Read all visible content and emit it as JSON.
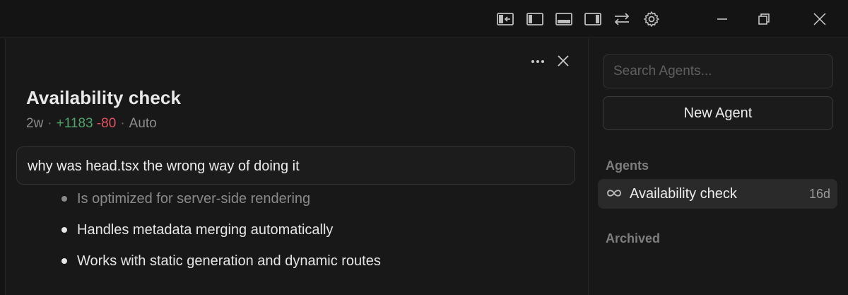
{
  "colors": {
    "background": "#181818",
    "titlebar": "#141414",
    "added": "#4fa36a",
    "removed": "#e0525e",
    "selected_item": "#2a2a2a"
  },
  "titlebar": {
    "icons": [
      "panel-toggle-left-arrow-icon",
      "layout-sidebar-left-icon",
      "layout-panel-bottom-icon",
      "layout-sidebar-right-icon",
      "swap-arrows-icon",
      "gear-icon"
    ],
    "window_controls": [
      "minimize-icon",
      "restore-icon",
      "close-icon"
    ]
  },
  "main": {
    "agent": {
      "title": "Availability check",
      "age": "2w",
      "sep": "·",
      "added": "+1183",
      "removed": "-80",
      "mode": "Auto"
    },
    "query": "why was head.tsx the wrong way of doing it",
    "bullets": [
      "Is optimized for server-side rendering",
      "Handles metadata merging automatically",
      "Works with static generation and dynamic routes"
    ]
  },
  "sidebar": {
    "search_placeholder": "Search Agents...",
    "new_agent_label": "New Agent",
    "agents_section": "Agents",
    "archived_section": "Archived",
    "agents": [
      {
        "label": "Availability check",
        "age": "16d",
        "icon": "infinity-icon"
      }
    ]
  }
}
